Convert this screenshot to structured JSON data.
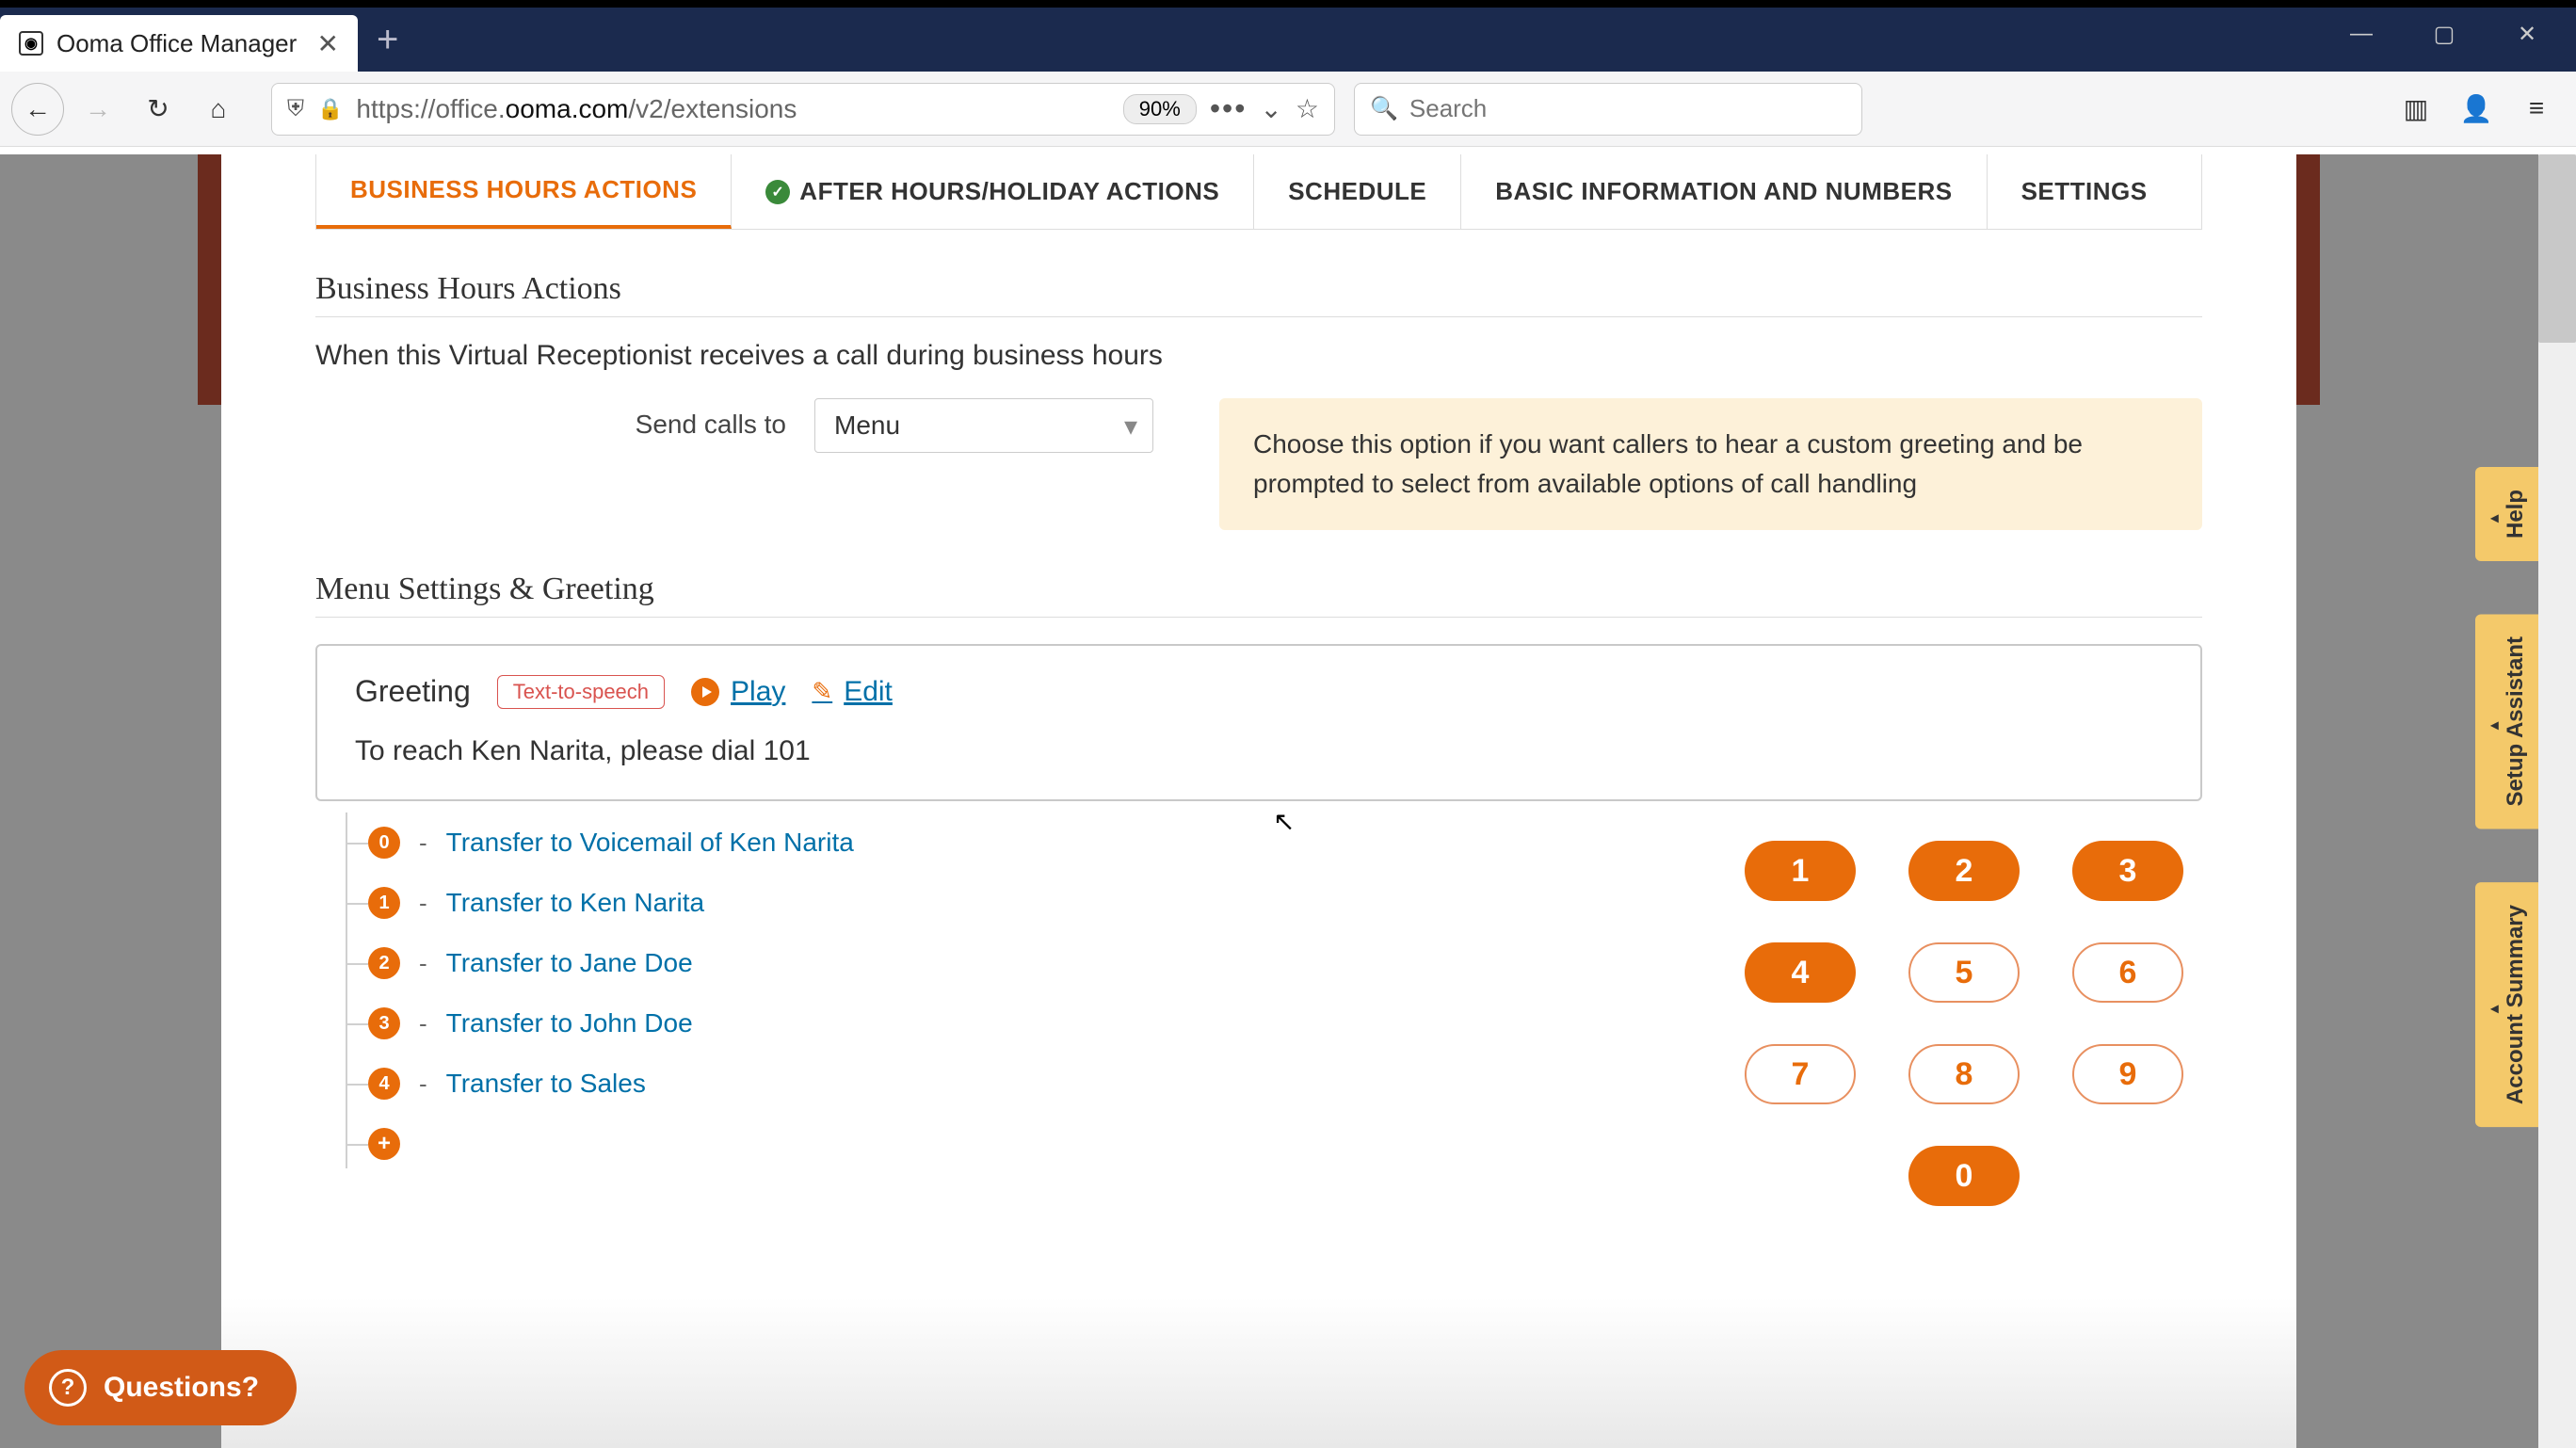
{
  "browser": {
    "tab_title": "Ooma Office Manager",
    "url_prefix": "https://office.",
    "url_domain": "ooma.com",
    "url_path": "/v2/extensions",
    "zoom": "90%",
    "search_placeholder": "Search"
  },
  "tabs": {
    "business_hours": "BUSINESS HOURS ACTIONS",
    "after_hours": "AFTER HOURS/HOLIDAY ACTIONS",
    "schedule": "SCHEDULE",
    "basic_info": "BASIC INFORMATION AND NUMBERS",
    "settings": "SETTINGS"
  },
  "sections": {
    "business_hours_title": "Business Hours Actions",
    "business_hours_desc": "When this Virtual Receptionist receives a call during business hours",
    "send_calls_label": "Send calls to",
    "send_calls_value": "Menu",
    "info_text": "Choose this option if you want callers to hear a custom greeting and be prompted to select from available options of call handling",
    "menu_settings_title": "Menu Settings & Greeting"
  },
  "greeting": {
    "label": "Greeting",
    "badge": "Text-to-speech",
    "play": "Play",
    "edit": "Edit",
    "text": "To reach Ken Narita, please dial 101"
  },
  "menu_items": [
    {
      "key": "0",
      "dash": "-",
      "action": "Transfer to Voicemail of Ken Narita"
    },
    {
      "key": "1",
      "dash": "-",
      "action": "Transfer to Ken Narita"
    },
    {
      "key": "2",
      "dash": "-",
      "action": "Transfer to Jane Doe"
    },
    {
      "key": "3",
      "dash": "-",
      "action": "Transfer to John Doe"
    },
    {
      "key": "4",
      "dash": "-",
      "action": "Transfer to Sales"
    }
  ],
  "keypad": {
    "k1": "1",
    "k2": "2",
    "k3": "3",
    "k4": "4",
    "k5": "5",
    "k6": "6",
    "k7": "7",
    "k8": "8",
    "k9": "9",
    "k0": "0"
  },
  "keypad_filled": [
    "1",
    "2",
    "3",
    "4",
    "0"
  ],
  "side_tabs": {
    "help": "Help",
    "setup": "Setup Assistant",
    "account": "Account Summary"
  },
  "questions": "Questions?"
}
